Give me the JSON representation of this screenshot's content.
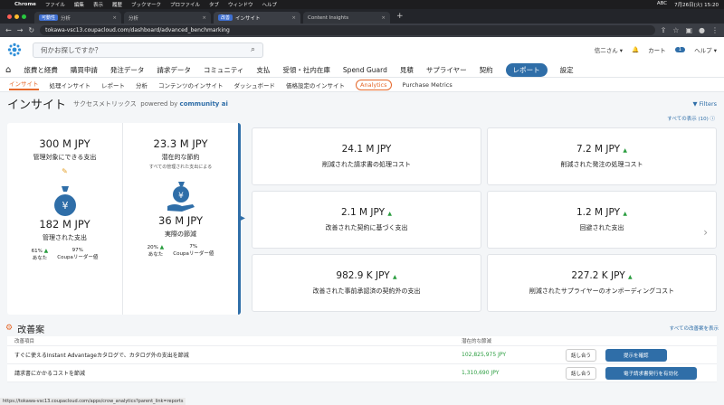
{
  "mac": {
    "app": "Chrome",
    "menus": [
      "ファイル",
      "編集",
      "表示",
      "履歴",
      "ブックマーク",
      "プロファイル",
      "タブ",
      "ウィンドウ",
      "ヘルプ"
    ],
    "right": [
      "ABC",
      "7月26日(火) 15:20"
    ]
  },
  "tabs": [
    {
      "group": "可動性",
      "title": "分析",
      "active": false
    },
    {
      "group": "",
      "title": "分析",
      "active": false
    },
    {
      "group": "改善",
      "title": "インサイト",
      "active": true
    },
    {
      "group": "",
      "title": "Content Insights",
      "active": false
    }
  ],
  "url": "tokawa-vsc13.coupacloud.com/dashboard/advanced_benchmarking",
  "search": {
    "placeholder": "何かお探しですか？"
  },
  "header": {
    "user": "信二さん ▾",
    "cart": "カート",
    "cart_count": "1",
    "help": "ヘルプ ▾"
  },
  "nav": [
    "旅費と経費",
    "購買申請",
    "発注データ",
    "請求データ",
    "コミュニティ",
    "支払",
    "受領・社内在庫",
    "Spend Guard",
    "見積",
    "サプライヤー",
    "契約",
    "レポート",
    "設定"
  ],
  "subnav": [
    "インサイト",
    "処理インサイト",
    "レポート",
    "分析",
    "コンテンツのインサイト",
    "ダッシュボード",
    "価格設定のインサイト",
    "Analytics",
    "Purchase Metrics"
  ],
  "title": {
    "main": "インサイト",
    "sub": "サクセスメトリックス",
    "powered": "powered by",
    "brand": "community ai",
    "filters": "Filters",
    "show_all": "すべての表示 (10)"
  },
  "left": {
    "a_value": "300 M JPY",
    "a_label": "管理対象にできる支出",
    "b_value": "23.3 M JPY",
    "b_label": "潜在的な節約",
    "b_note": "すべての管理された支出による",
    "c_value": "182 M JPY",
    "c_label": "管理された支出",
    "d_value": "36 M JPY",
    "d_label": "実際の節減",
    "c_you": "61%",
    "c_you_lbl": "あなた",
    "c_leader": "97%",
    "c_leader_lbl": "Coupaリーダー値",
    "d_you": "20%",
    "d_you_lbl": "あなた",
    "d_leader": "7%",
    "d_leader_lbl": "Coupaリーダー値"
  },
  "cards": [
    {
      "value": "24.1 M JPY",
      "label": "削減された請求書の処理コスト"
    },
    {
      "value": "7.2 M JPY",
      "label": "削減された発注の処理コスト"
    },
    {
      "value": "2.1 M JPY",
      "label": "改善された契約に基づく支出"
    },
    {
      "value": "1.2 M JPY",
      "label": "回避された支出"
    },
    {
      "value": "982.9 K JPY",
      "label": "改善された事前承認済の契約外の支出"
    },
    {
      "value": "227.2 K JPY",
      "label": "削減されたサプライヤーのオンボーディングコスト"
    }
  ],
  "improve": {
    "title": "改善案",
    "show_all": "すべての改善案を表示",
    "col1": "改善項目",
    "col2": "潜在的な節減",
    "rows": [
      {
        "item": "すぐに使えるInstant Advantageカタログで、カタログ外の支出を節減",
        "value": "102,825,975 JPY",
        "talk": "話し合う",
        "action": "提示を確認"
      },
      {
        "item": "請求書にかかるコストを節減",
        "value": "1,310,690 JPY",
        "talk": "話し合う",
        "action": "電子請求書発行を有効化"
      }
    ]
  },
  "status_url": "https://tokawa-vsc13.coupacloud.com/apps/crow_analytics?parent_link=reports"
}
